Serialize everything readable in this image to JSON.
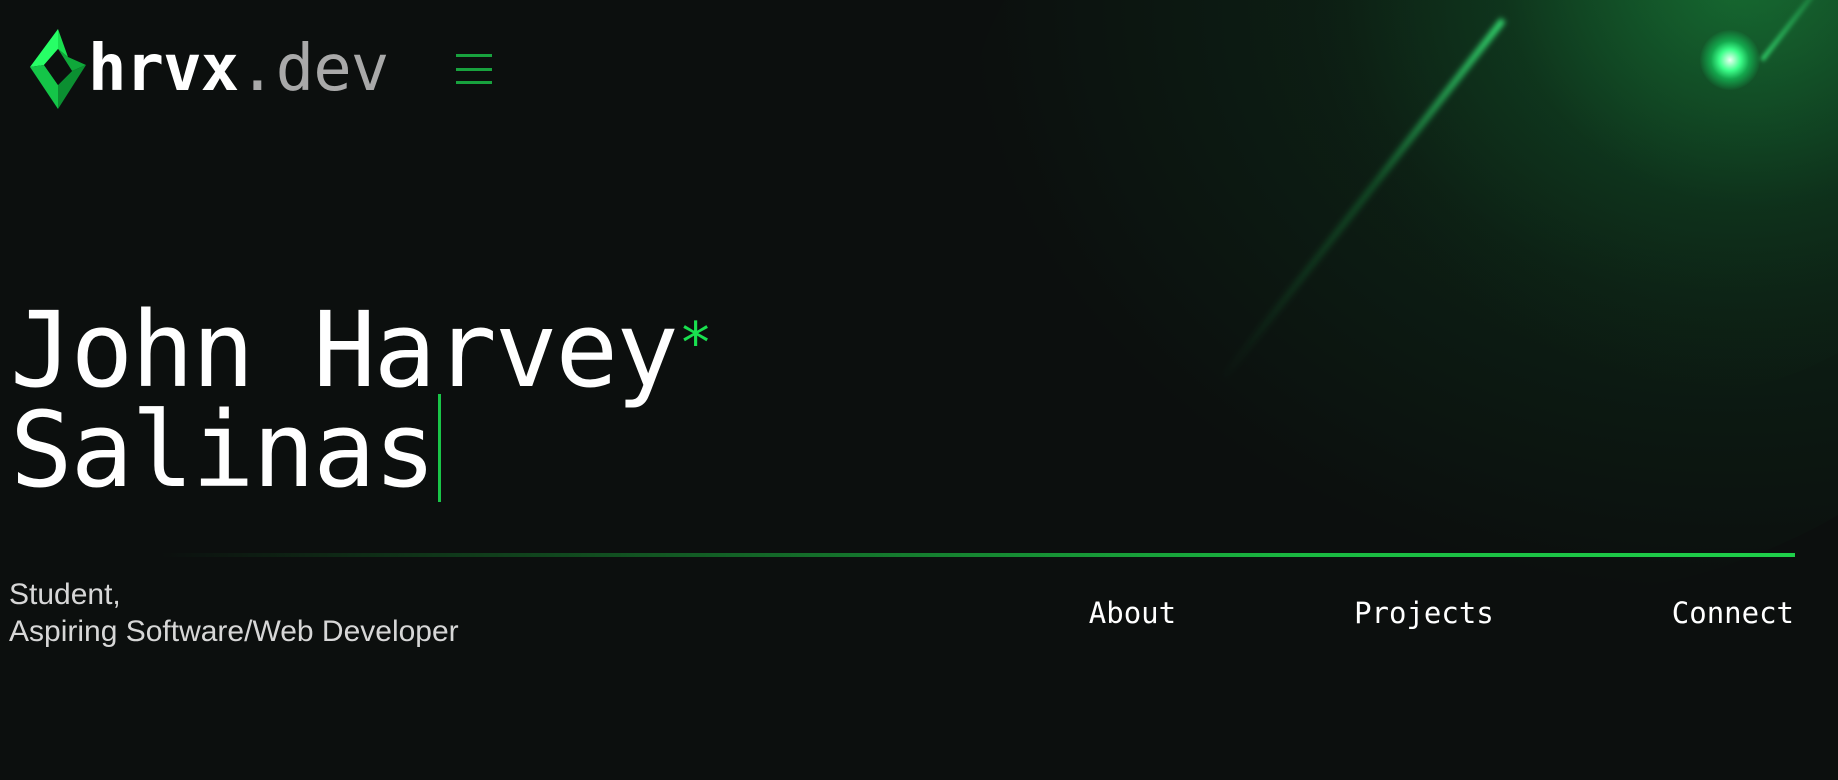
{
  "brand": {
    "name": "hrvx",
    "tld": ".dev",
    "logo_icon": "diamond-logo-icon",
    "accent_color": "#19e04f"
  },
  "header": {
    "menu_icon": "hamburger-menu-icon"
  },
  "hero": {
    "first_line": "John Harvey",
    "asterisk": "*",
    "second_line": "Salinas"
  },
  "tagline": {
    "line1": "Student,",
    "line2": "Aspiring Software/Web Developer"
  },
  "nav": {
    "items": [
      {
        "label": "About"
      },
      {
        "label": "Projects"
      },
      {
        "label": "Connect"
      }
    ]
  }
}
